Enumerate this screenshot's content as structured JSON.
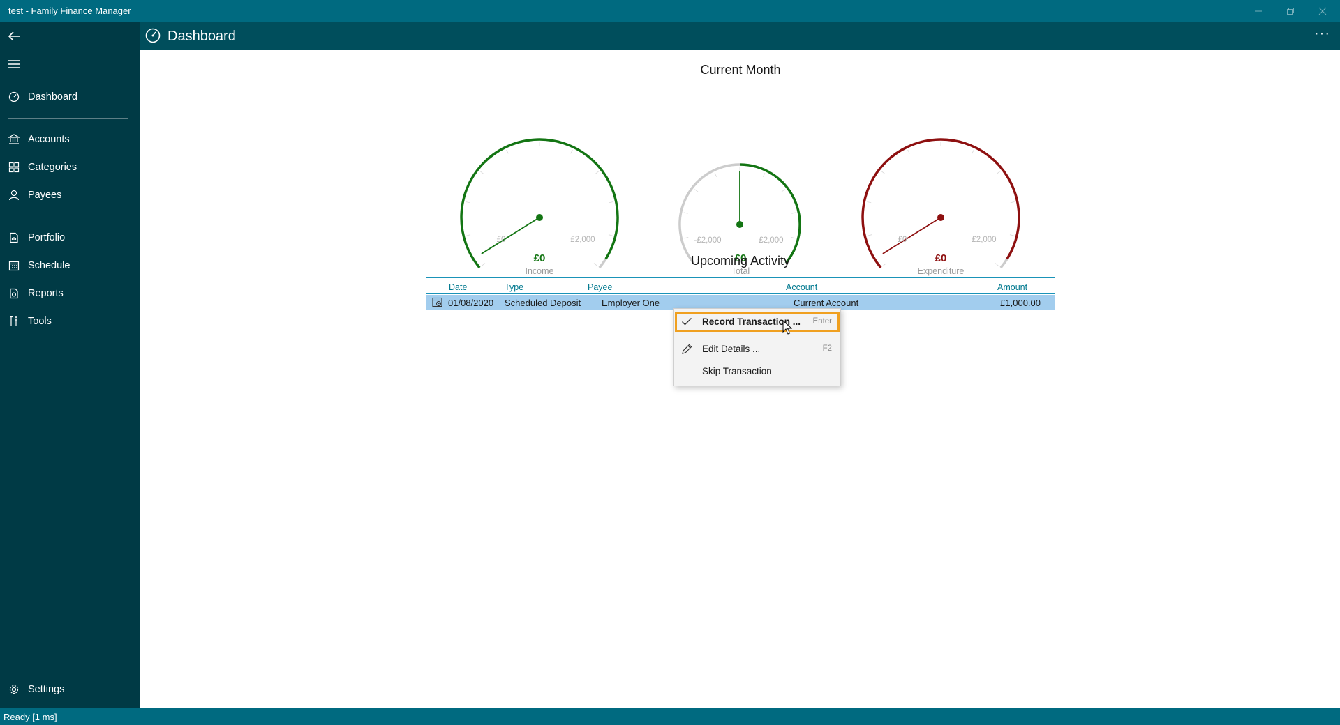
{
  "window": {
    "title": "test - Family Finance Manager"
  },
  "colors": {
    "income": "#137513",
    "expenditure": "#8e1010",
    "neutral": "#cccccc",
    "accent": "#006a80",
    "selection": "#a2cdee",
    "focus": "#f0a020"
  },
  "sidebar": {
    "back_icon": "back-arrow-icon",
    "menu_icon": "hamburger-icon",
    "items": [
      {
        "label": "Dashboard",
        "icon": "dashboard-icon"
      },
      {
        "label": "Accounts",
        "icon": "bank-icon"
      },
      {
        "label": "Categories",
        "icon": "categories-icon"
      },
      {
        "label": "Payees",
        "icon": "person-icon"
      },
      {
        "label": "Portfolio",
        "icon": "portfolio-icon"
      },
      {
        "label": "Schedule",
        "icon": "calendar-icon"
      },
      {
        "label": "Reports",
        "icon": "report-icon"
      },
      {
        "label": "Tools",
        "icon": "tools-icon"
      }
    ],
    "settings": {
      "label": "Settings",
      "icon": "gear-icon"
    }
  },
  "header": {
    "title": "Dashboard",
    "more": "···"
  },
  "dashboard": {
    "current_month_title": "Current Month",
    "gauges": [
      {
        "label": "Income",
        "value": "£0",
        "min_label": "£0",
        "max_label": "£2,000"
      },
      {
        "label": "Total",
        "value": "£0",
        "min_label": "-£2,000",
        "max_label": "£2,000"
      },
      {
        "label": "Expenditure",
        "value": "£0",
        "min_label": "£0",
        "max_label": "£2,000"
      }
    ],
    "upcoming_title": "Upcoming Activity",
    "columns": [
      "Date",
      "Type",
      "Payee",
      "Account",
      "Amount"
    ],
    "rows": [
      {
        "date": "01/08/2020",
        "type": "Scheduled Deposit",
        "payee": "Employer One",
        "account": "Current Account",
        "amount": "£1,000.00"
      }
    ]
  },
  "context_menu": {
    "items": [
      {
        "label": "Record Transaction ...",
        "shortcut": "Enter",
        "icon": "checkmark-icon"
      },
      {
        "label": "Edit Details ...",
        "shortcut": "F2",
        "icon": "pencil-icon"
      },
      {
        "label": "Skip Transaction",
        "shortcut": "",
        "icon": ""
      }
    ]
  },
  "status": {
    "text": "Ready [1 ms]"
  }
}
